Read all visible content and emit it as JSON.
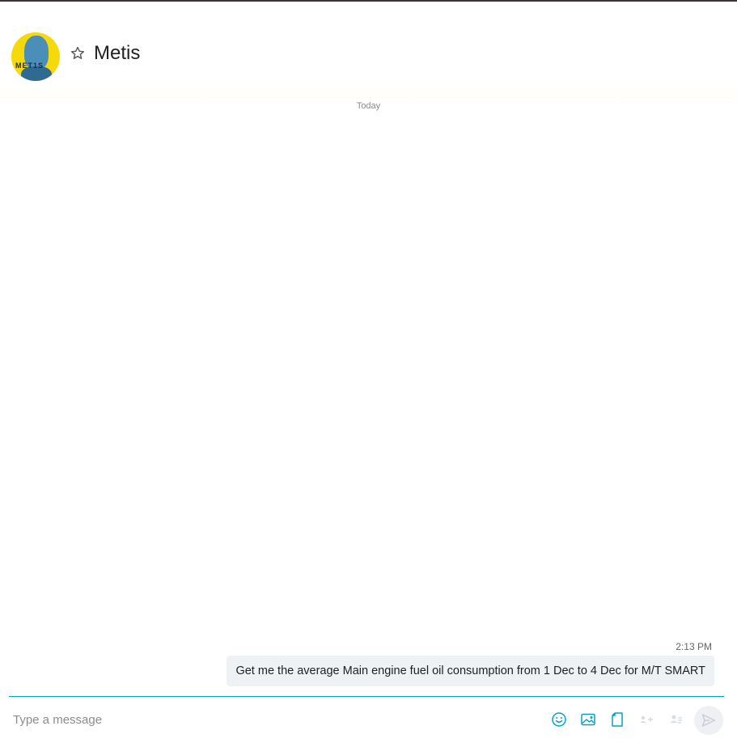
{
  "header": {
    "contact_name": "Metis",
    "avatar_text": "MET1S",
    "favorite_icon": "star-outline-icon"
  },
  "conversation": {
    "date_separator": "Today",
    "messages": [
      {
        "time": "2:13 PM",
        "text": "Get me the average Main engine fuel oil consumption from 1 Dec to 4 Dec for M/T SMART",
        "direction": "outgoing"
      }
    ]
  },
  "composer": {
    "placeholder": "Type a message",
    "value": "",
    "tools": [
      "emoji-icon",
      "image-icon",
      "file-icon",
      "contact-card-icon",
      "add-contact-icon"
    ],
    "send_icon": "send-icon"
  },
  "colors": {
    "accent": "#00a3c7",
    "bubble_bg": "#eff2f5",
    "avatar_bg": "#f5d90a"
  }
}
